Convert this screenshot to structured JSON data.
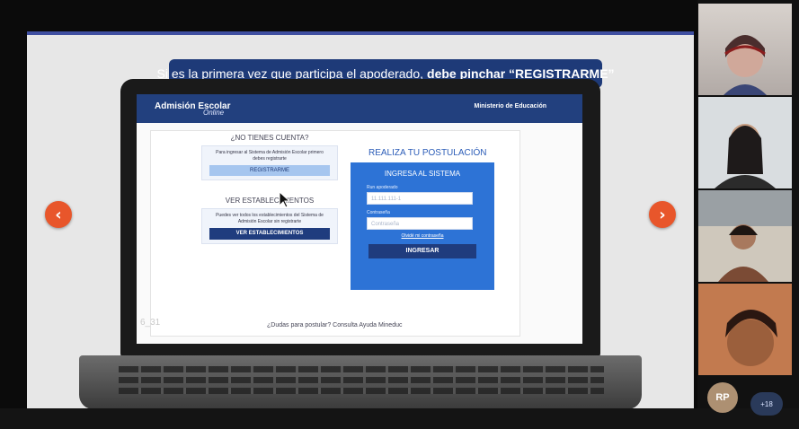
{
  "banner": {
    "normal": "Si es la primera vez que participa el apoderado,",
    "bold": "debe pinchar “REGISTRARME”"
  },
  "site": {
    "logo_main": "Admisión Escolar",
    "logo_sub": "Online",
    "ministry": "Ministerio de Educación"
  },
  "left": {
    "no_account_title": "¿NO TIENES CUENTA?",
    "register_desc": "Para ingresar al Sistema de Admisión Escolar primero debes registrarte",
    "register_button": "REGISTRARME",
    "establishments_title": "VER ESTABLECIMIENTOS",
    "establishments_desc": "Puedes ver todos los establecimientos del Sistema de Admisión Escolar sin registrarte",
    "establishments_button": "VER ESTABLECIMIENTOS"
  },
  "right": {
    "title": "REALIZA TU POSTULACIÓN",
    "panel_title": "INGRESA AL SISTEMA",
    "rut_label": "Run apoderado",
    "rut_placeholder": "11.111.111-1",
    "password_label": "Contraseña",
    "password_placeholder": "Contraseña",
    "forgot": "Olvidé mi contraseña",
    "login_button": "INGRESAR"
  },
  "footer": {
    "question": "¿Dudas para postular?",
    "help": "Consulta Ayuda Mineduc"
  },
  "screen_id": "6_31",
  "participants": {
    "avatar_initials": "RP",
    "more_count": "+18"
  },
  "colors": {
    "brand_blue": "#22407e",
    "panel_blue": "#2d73d6",
    "accent_orange": "#e8562b"
  }
}
